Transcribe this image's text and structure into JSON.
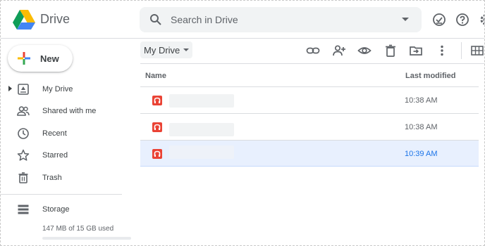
{
  "app": {
    "brand": "Drive",
    "logo_icon": "drive-logo-icon"
  },
  "search": {
    "placeholder": "Search in Drive"
  },
  "header_icons": [
    "offline-ready-icon",
    "help-icon",
    "settings-icon"
  ],
  "new_button": {
    "label": "New"
  },
  "sidebar": {
    "items": [
      {
        "label": "My Drive",
        "icon": "my-drive-icon"
      },
      {
        "label": "Shared with me",
        "icon": "shared-with-me-icon"
      },
      {
        "label": "Recent",
        "icon": "clock-icon"
      },
      {
        "label": "Starred",
        "icon": "star-icon"
      },
      {
        "label": "Trash",
        "icon": "trash-icon"
      }
    ],
    "storage": {
      "label": "Storage",
      "used_text": "147 MB of 15 GB used"
    }
  },
  "toolbar": {
    "path_label": "My Drive",
    "icons": [
      "link-icon",
      "add-person-icon",
      "preview-eye-icon",
      "delete-icon",
      "move-to-icon",
      "more-vert-icon",
      "grid-view-icon"
    ]
  },
  "file_list": {
    "columns": {
      "name": "Name",
      "last_modified": "Last modified"
    },
    "rows": [
      {
        "file_icon": "pdf-file-icon",
        "modified": "10:38 AM",
        "selected": false
      },
      {
        "file_icon": "pdf-file-icon",
        "modified": "10:38 AM",
        "selected": false
      },
      {
        "file_icon": "pdf-file-icon",
        "modified": "10:39 AM",
        "selected": true
      }
    ]
  },
  "colors": {
    "accent": "#1a73e8",
    "selected_row": "#e8f0fe",
    "file_icon": "#ea4335"
  }
}
